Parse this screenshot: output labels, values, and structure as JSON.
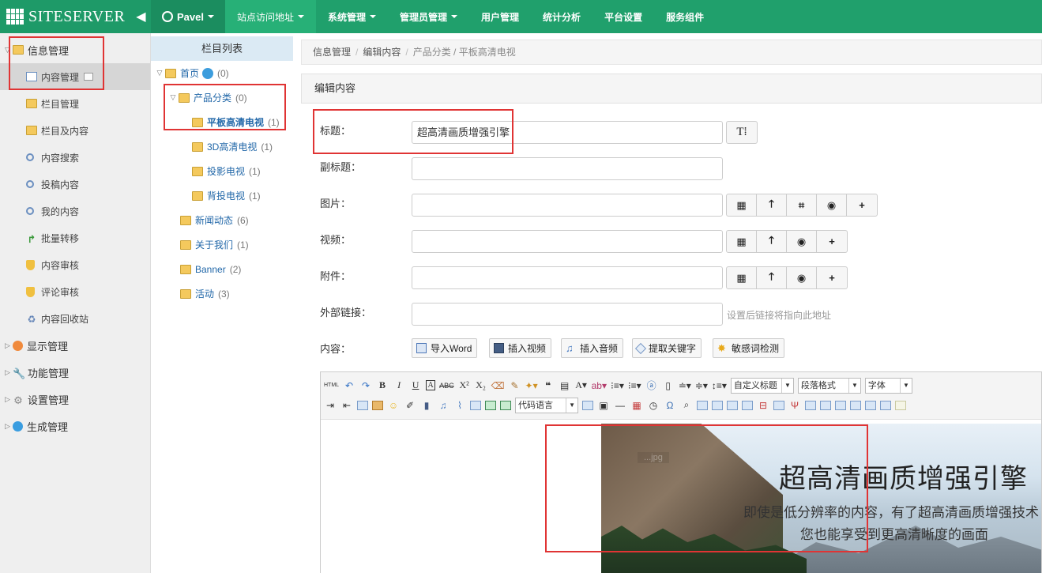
{
  "topbar": {
    "logo": "SITESERVER",
    "user": "Pavel",
    "nav": [
      "站点访问地址",
      "系统管理",
      "管理员管理",
      "用户管理",
      "统计分析",
      "平台设置",
      "服务组件"
    ]
  },
  "sidebar": {
    "group_info": "信息管理",
    "items": [
      "内容管理",
      "栏目管理",
      "栏目及内容",
      "内容搜索",
      "投稿内容",
      "我的内容",
      "批量转移",
      "内容审核",
      "评论审核",
      "内容回收站"
    ],
    "groups": [
      "显示管理",
      "功能管理",
      "设置管理",
      "生成管理"
    ]
  },
  "tree": {
    "header": "栏目列表",
    "nodes": [
      {
        "label": "首页",
        "count": "(0)"
      },
      {
        "label": "产品分类",
        "count": "(0)"
      },
      {
        "label": "平板高清电视",
        "count": "(1)"
      },
      {
        "label": "3D高清电视",
        "count": "(1)"
      },
      {
        "label": "投影电视",
        "count": "(1)"
      },
      {
        "label": "背投电视",
        "count": "(1)"
      },
      {
        "label": "新闻动态",
        "count": "(6)"
      },
      {
        "label": "关于我们",
        "count": "(1)"
      },
      {
        "label": "Banner",
        "count": "(2)"
      },
      {
        "label": "活动",
        "count": "(3)"
      }
    ]
  },
  "breadcrumb": {
    "a": "信息管理",
    "b": "编辑内容",
    "c": "产品分类 / 平板高清电视"
  },
  "panel_title": "编辑内容",
  "form": {
    "title_label": "标题：",
    "title_value": "超高清画质增强引擎",
    "title_btn": "T⁞",
    "subtitle_label": "副标题：",
    "image_label": "图片：",
    "video_label": "视频：",
    "attach_label": "附件：",
    "link_label": "外部链接：",
    "link_hint": "设置后链接将指向此地址",
    "content_label": "内容："
  },
  "content_tools": [
    "导入Word",
    "插入视频",
    "插入音频",
    "提取关键字",
    "敏感词检测"
  ],
  "editor": {
    "html_label": "HTML",
    "selects": [
      "自定义标题",
      "段落格式",
      "字体",
      "代码语言"
    ]
  },
  "banner": {
    "watermark": "...jpg",
    "title": "超高清画质增强引擎",
    "line1": "即使是低分辨率的内容，有了超高清画质增强技术",
    "line2": "您也能享受到更高清晰度的画面"
  }
}
